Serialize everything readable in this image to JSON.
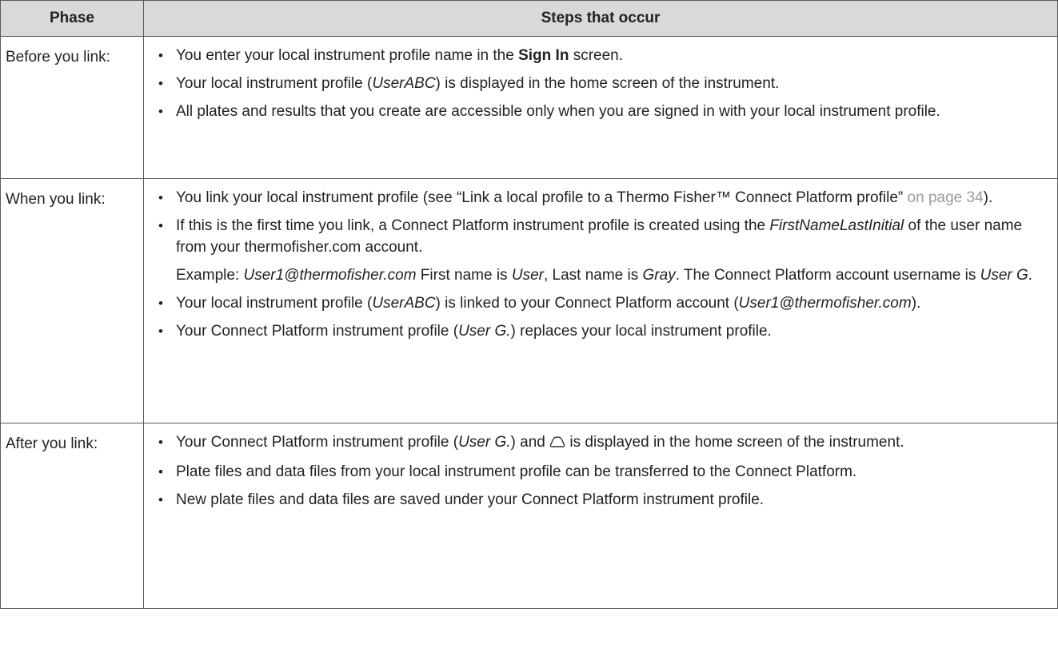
{
  "header": {
    "phase": "Phase",
    "steps": "Steps that occur"
  },
  "rows": [
    {
      "phase": "Before you link:",
      "steps": [
        {
          "a": "You enter your local instrument profile name in the ",
          "b": "Sign In",
          "c": " screen."
        },
        {
          "a": "Your local instrument profile (",
          "i": "UserABC",
          "c": ") is displayed in the home screen of the instrument."
        },
        {
          "a": "All plates and results that you create are accessible only when you are signed in with your local instrument profile."
        }
      ]
    },
    {
      "phase": "When you link:",
      "steps": [
        {
          "a": "You link your local instrument profile (see “Link a local profile to a Thermo Fisher™ Connect Platform profile”",
          "x": " on page 34",
          "c": ")."
        },
        {
          "a": "If this is the first time you link, a Connect Platform instrument profile is created using the ",
          "i": "FirstNameLastInitial",
          "c": " of the user name from your thermofisher.com account.",
          "ex": {
            "lead": "Example: ",
            "email": "User1@thermofisher.com",
            "t1": " First name is ",
            "first": "User",
            "t2": ", Last name is ",
            "last": "Gray",
            "t3": ". The Connect Platform account username is ",
            "uname": "User G",
            "t4": "."
          }
        },
        {
          "a": "Your local instrument profile (",
          "i": "UserABC",
          "c": ") is linked to your Connect Platform account (",
          "i2": "User1@thermofisher.com",
          "d": ")."
        },
        {
          "a": "Your Connect Platform instrument profile (",
          "i": "User G.",
          "c": ") replaces your local instrument profile."
        }
      ]
    },
    {
      "phase": "After you link:",
      "steps": [
        {
          "a": "Your Connect Platform instrument profile (",
          "i": "User G.",
          "c": ") and ",
          "d": " is displayed in the home screen of the instrument."
        },
        {
          "a": "Plate files and data files from your local instrument profile can be transferred to the Connect Platform."
        },
        {
          "a": "New plate files and data files are saved under your Connect Platform instrument profile."
        }
      ]
    }
  ],
  "bullet": "•",
  "icons": {
    "cloud": "cloud-icon"
  }
}
